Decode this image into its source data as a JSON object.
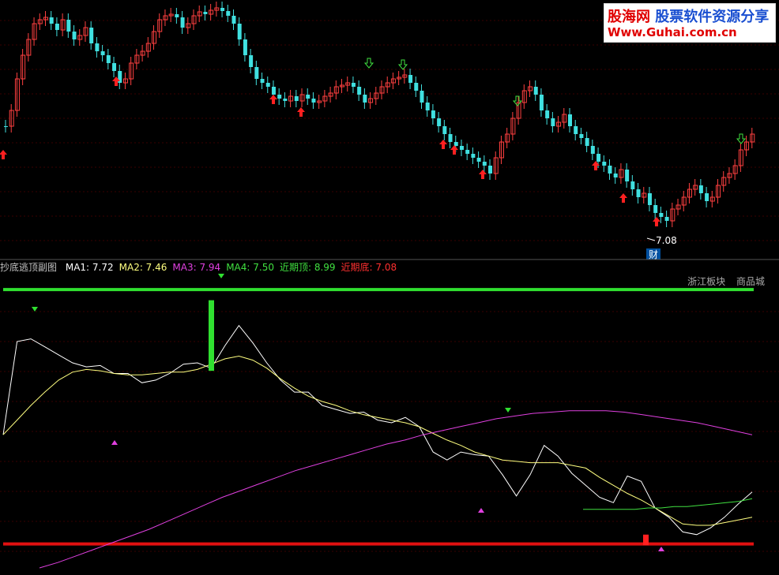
{
  "watermark": {
    "site_cn": "股海网",
    "slogan": "股票软件资源分享",
    "url": "Www.Guhai.com.cn"
  },
  "upper_panel": {
    "low_label": "7.08",
    "event_badge": "财"
  },
  "indicator": {
    "name": "抄底逃顶副图",
    "items": [
      {
        "label": "MA1:",
        "value": "7.72",
        "color": "#ffffff"
      },
      {
        "label": "MA2:",
        "value": "7.46",
        "color": "#ffff80"
      },
      {
        "label": "MA3:",
        "value": "7.94",
        "color": "#e040e0"
      },
      {
        "label": "MA4:",
        "value": "7.50",
        "color": "#40e040"
      },
      {
        "label": "近期顶:",
        "value": "8.99",
        "color": "#40e040"
      },
      {
        "label": "近期底:",
        "value": "7.08",
        "color": "#ff3030"
      }
    ],
    "tags": [
      "浙江板块",
      "商品城"
    ]
  },
  "chart_data": {
    "type": "line",
    "series": [
      {
        "name": "MA1",
        "color": "#ffffff",
        "values": [
          7.9,
          8.6,
          8.62,
          8.56,
          8.5,
          8.44,
          8.41,
          8.42,
          8.36,
          8.36,
          8.29,
          8.31,
          8.36,
          8.43,
          8.44,
          8.4,
          8.57,
          8.72,
          8.59,
          8.44,
          8.31,
          8.22,
          8.22,
          8.12,
          8.09,
          8.06,
          8.07,
          8.01,
          7.99,
          8.03,
          7.96,
          7.77,
          7.71,
          7.77,
          7.75,
          7.74,
          7.6,
          7.44,
          7.6,
          7.82,
          7.74,
          7.61,
          7.52,
          7.43,
          7.39,
          7.59,
          7.55,
          7.35,
          7.28,
          7.17,
          7.15,
          7.2,
          7.28,
          7.38,
          7.47
        ]
      },
      {
        "name": "MA2",
        "color": "#ffff80",
        "values": [
          7.9,
          8.01,
          8.12,
          8.22,
          8.31,
          8.37,
          8.39,
          8.38,
          8.36,
          8.35,
          8.35,
          8.36,
          8.37,
          8.37,
          8.39,
          8.43,
          8.47,
          8.49,
          8.46,
          8.4,
          8.32,
          8.25,
          8.19,
          8.15,
          8.12,
          8.08,
          8.05,
          8.03,
          8.01,
          7.99,
          7.96,
          7.91,
          7.86,
          7.82,
          7.77,
          7.74,
          7.71,
          7.7,
          7.69,
          7.69,
          7.69,
          7.67,
          7.65,
          7.58,
          7.52,
          7.46,
          7.41,
          7.35,
          7.29,
          7.23,
          7.22,
          7.22,
          7.24,
          7.26,
          7.28
        ]
      },
      {
        "name": "MA3",
        "color": "#e040e0",
        "values": [
          6.9,
          6.94,
          6.99,
          7.04,
          7.09,
          7.14,
          7.19,
          7.25,
          7.31,
          7.37,
          7.43,
          7.48,
          7.53,
          7.58,
          7.63,
          7.67,
          7.71,
          7.75,
          7.79,
          7.83,
          7.86,
          7.9,
          7.93,
          7.96,
          7.99,
          8.02,
          8.04,
          8.06,
          8.07,
          8.08,
          8.08,
          8.08,
          8.07,
          8.05,
          8.03,
          8.01,
          7.99,
          7.96,
          7.93,
          7.9
        ]
      },
      {
        "name": "MA4",
        "color": "#40e040",
        "values": [
          7.34,
          7.34,
          7.34,
          7.34,
          7.34,
          7.35,
          7.35,
          7.36,
          7.36,
          7.37,
          7.38,
          7.39,
          7.4,
          7.42
        ]
      }
    ],
    "ylim": [
      6.9,
      9.05
    ],
    "recent_top": 8.99,
    "recent_bottom": 7.08,
    "signal_bars": [
      {
        "color": "#30e030",
        "from": 8.38,
        "to": 8.91
      },
      {
        "color": "#ff2020",
        "from": 7.07,
        "to": 7.15
      }
    ]
  }
}
